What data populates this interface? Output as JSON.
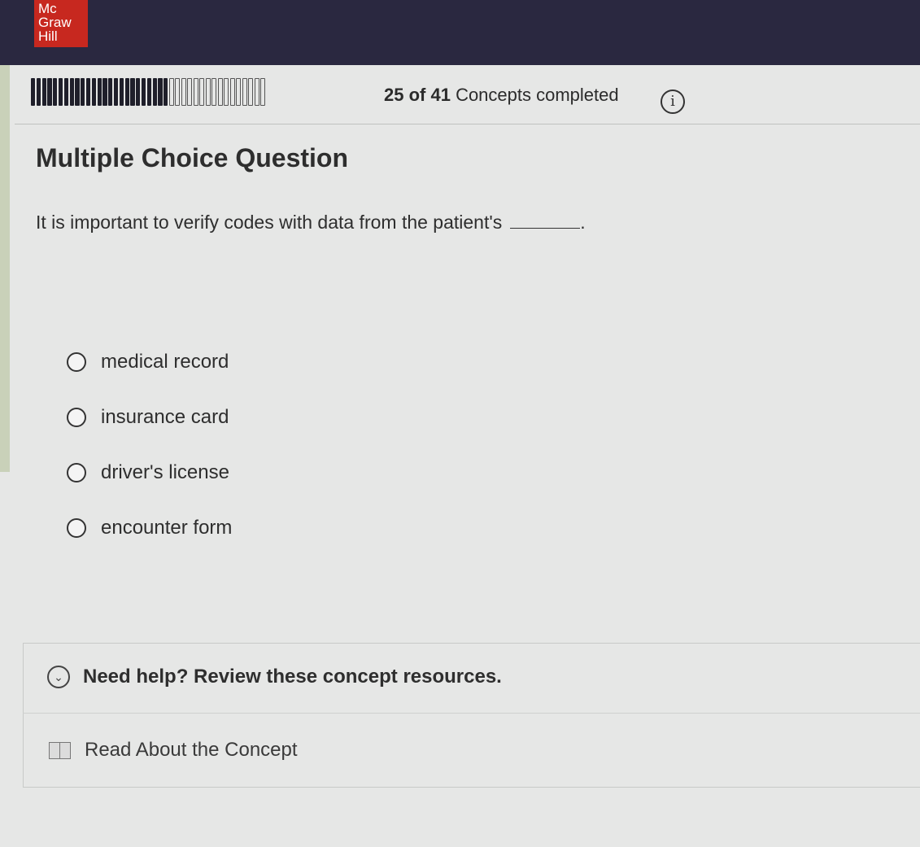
{
  "brand": {
    "logo_lines": [
      "Mc",
      "Graw",
      "Hill"
    ],
    "color": "#c7281f"
  },
  "progress": {
    "completed": 25,
    "total": 41,
    "count_text": "25 of 41",
    "label": "Concepts completed"
  },
  "question": {
    "heading": "Multiple Choice Question",
    "text": "It is important to verify codes with data from the patient's",
    "trailing": ".",
    "options": [
      {
        "label": "medical record"
      },
      {
        "label": "insurance card"
      },
      {
        "label": "driver's license"
      },
      {
        "label": "encounter form"
      }
    ]
  },
  "help": {
    "title": "Need help? Review these concept resources.",
    "resource_label": "Read About the Concept"
  },
  "icons": {
    "info": "info-icon",
    "chevron": "chevron-down-circle-icon",
    "book": "book-icon"
  }
}
